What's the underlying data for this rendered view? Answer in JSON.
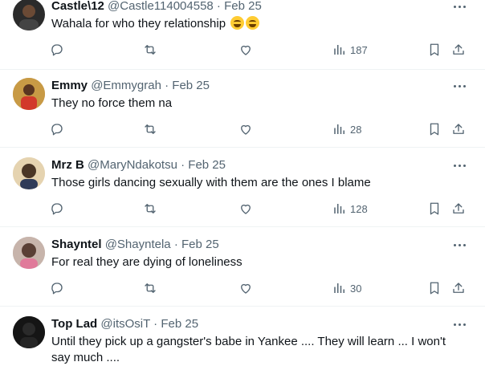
{
  "tweets": [
    {
      "name": "Castle\\12",
      "handle": "@Castle114004558",
      "date": "Feb 25",
      "text": "Wahala for who they relationship",
      "emoji": "😂😂",
      "views": "187",
      "avatar_color": "#2b2b2b"
    },
    {
      "name": "Emmy",
      "handle": "@Emmygrah",
      "date": "Feb 25",
      "text": "They no force them na",
      "views": "28",
      "avatar_color": "#7a4a2a"
    },
    {
      "name": "Mrz B",
      "handle": "@MaryNdakotsu",
      "date": "Feb 25",
      "text": "Those girls dancing sexually with them are the ones I blame",
      "views": "128",
      "avatar_color": "#4a3626"
    },
    {
      "name": "Shayntel",
      "handle": "@Shayntela",
      "date": "Feb 25",
      "text": "For real they are dying of loneliness",
      "views": "30",
      "avatar_color": "#5a3f35"
    },
    {
      "name": "Top Lad",
      "handle": "@itsOsiT",
      "date": "Feb 25",
      "text": "Until they pick up a gangster's babe in Yankee .... They will learn ... I won't say much ....",
      "avatar_color": "#111111"
    }
  ],
  "separator": " · ",
  "colors": {
    "secondary_text": "#536471",
    "divider": "#eff3f4"
  },
  "icons": [
    "reply-icon",
    "retweet-icon",
    "like-icon",
    "views-icon",
    "bookmark-icon",
    "share-icon",
    "more-icon"
  ]
}
